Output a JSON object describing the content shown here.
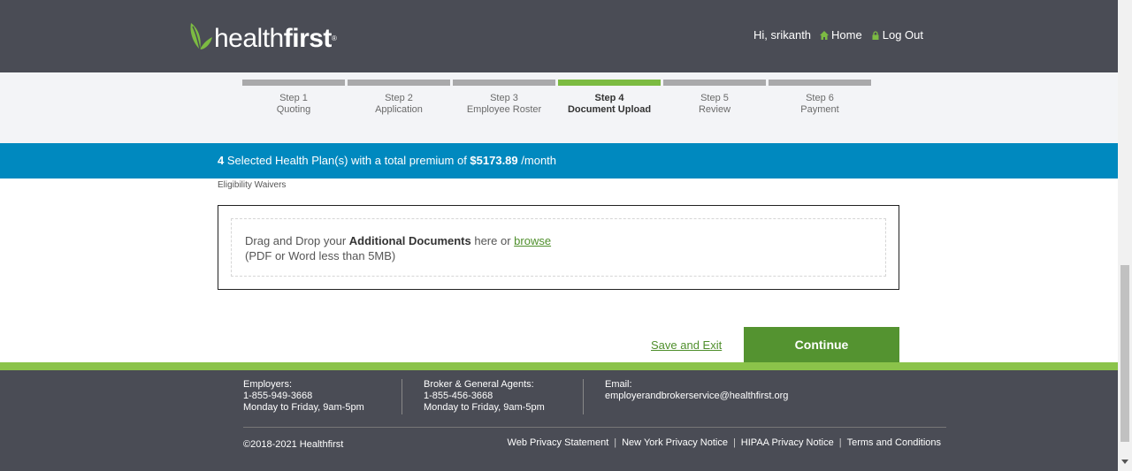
{
  "header": {
    "logo_light": "health",
    "logo_bold": "first",
    "logo_mark": "®",
    "greeting": "Hi, srikanth",
    "home_label": "Home",
    "logout_label": "Log Out",
    "accent_color": "#7cbb42"
  },
  "steps": [
    {
      "num": "Step 1",
      "label": "Quoting"
    },
    {
      "num": "Step 2",
      "label": "Application"
    },
    {
      "num": "Step 3",
      "label": "Employee Roster"
    },
    {
      "num": "Step 4",
      "label": "Document Upload"
    },
    {
      "num": "Step 5",
      "label": "Review"
    },
    {
      "num": "Step 6",
      "label": "Payment"
    }
  ],
  "banner": {
    "count": "4",
    "text1": " Selected Health Plan(s) with a total premium of ",
    "amount": "$5173.89",
    "text2": " /month",
    "color": "#0089bf"
  },
  "section_label": "Eligibility Waivers",
  "upload": {
    "pre": "Drag and Drop your ",
    "bold": "Additional Documents",
    "mid": " here or ",
    "browse": "browse",
    "hint": "(PDF or Word less than 5MB)"
  },
  "actions": {
    "save_exit": "Save and Exit",
    "continue": "Continue"
  },
  "footer": {
    "employers_title": "Employers:",
    "employers_phone": "1-855-949-3668",
    "employers_hours": "Monday to Friday, 9am-5pm",
    "brokers_title": "Broker & General Agents:",
    "brokers_phone": "1-855-456-3668",
    "brokers_hours": "Monday to Friday, 9am-5pm",
    "email_title": "Email:",
    "email": "employerandbrokerservice@healthfirst.org",
    "copyright": "©2018-2021 Healthfirst",
    "links": [
      "Web Privacy Statement",
      "New York Privacy Notice",
      "HIPAA Privacy Notice",
      "Terms and Conditions"
    ]
  }
}
